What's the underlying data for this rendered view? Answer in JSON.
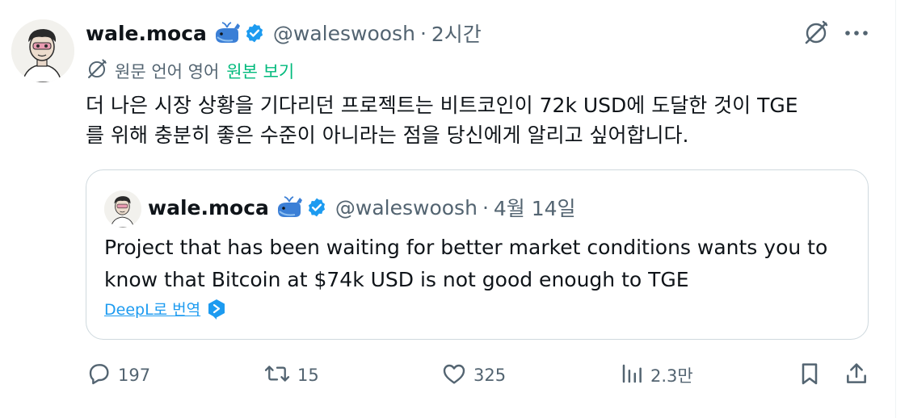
{
  "tweet": {
    "display_name": "wale.moca",
    "handle": "@waleswoosh",
    "separator": "·",
    "time": "2시간",
    "translate_label": "원문 언어 영어",
    "show_original": "원본 보기",
    "text_lines": [
      "더 나은 시장 상황을 기다리던 프로젝트는 비트코인이 72k USD에 도달한 것이 TGE",
      "를 위해 충분히 좋은 수준이 아니라는 점을 당신에게 알리고 싶어합니다."
    ]
  },
  "quote": {
    "display_name": "wale.moca",
    "handle": "@waleswoosh",
    "separator": "·",
    "date": "4월 14일",
    "text_lines": [
      "Project that has been waiting for better market conditions wants you to",
      "know that Bitcoin at $74k USD is not good enough to TGE"
    ],
    "deepl_label": "DeepL로 번역"
  },
  "actions": {
    "replies": "197",
    "reposts": "15",
    "likes": "325",
    "views": "2.3만"
  },
  "colors": {
    "text": "#0f1419",
    "muted": "#536471",
    "link_blue": "#1d9bf0",
    "green": "#00ba7c",
    "border": "#cfd9de"
  },
  "icons": [
    "grok-icon",
    "more-icon",
    "whale-icon",
    "verified-icon",
    "translate-icon",
    "deepl-icon",
    "reply-icon",
    "repost-icon",
    "like-icon",
    "views-icon",
    "bookmark-icon",
    "share-icon"
  ]
}
